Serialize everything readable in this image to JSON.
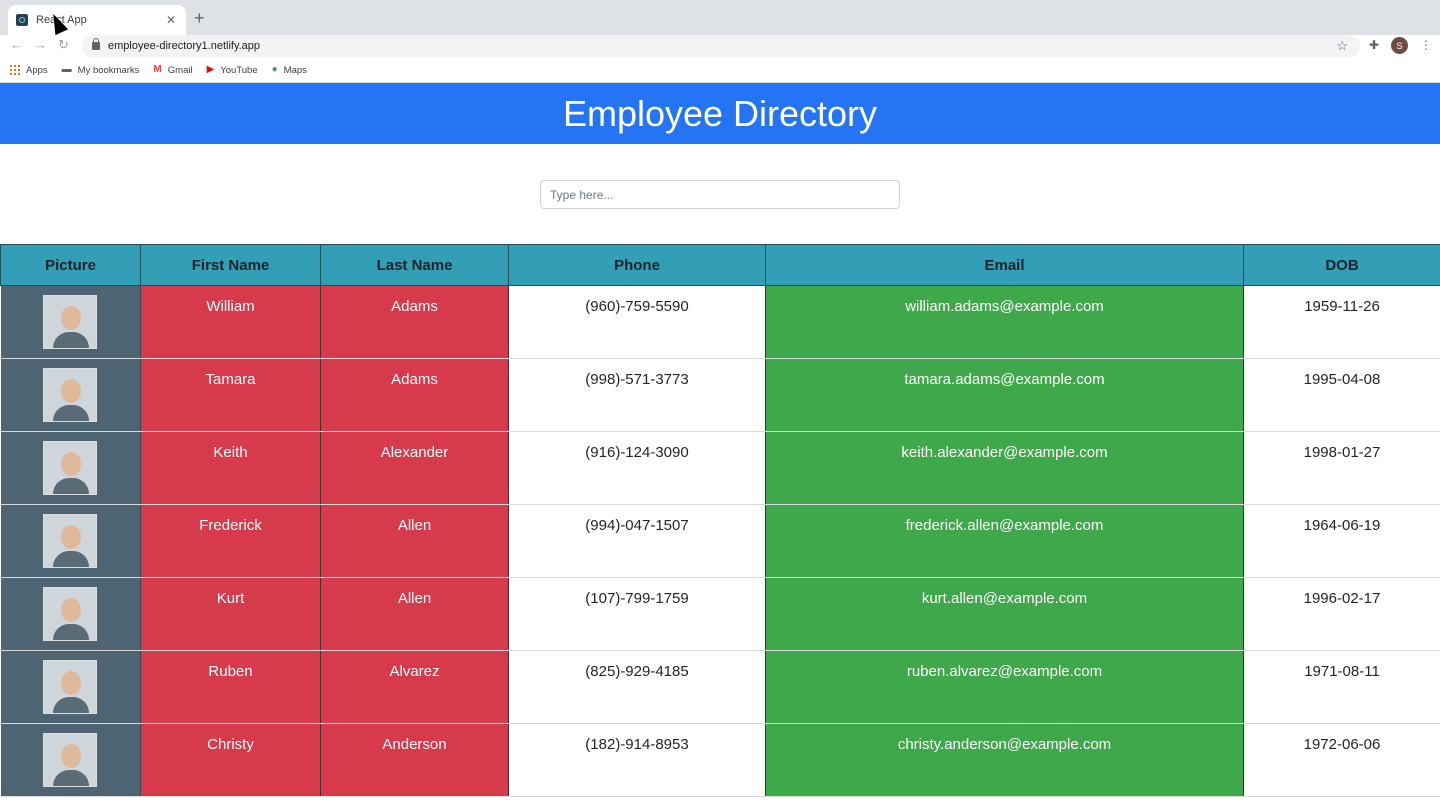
{
  "browser": {
    "tab_title": "React App",
    "url": "employee-directory1.netlify.app",
    "profile_initial": "S",
    "bookmarks": [
      {
        "label": "Apps",
        "icon": "apps-grid-icon"
      },
      {
        "label": "My bookmarks",
        "icon": "folder-icon"
      },
      {
        "label": "Gmail",
        "icon": "gmail-icon"
      },
      {
        "label": "YouTube",
        "icon": "youtube-icon"
      },
      {
        "label": "Maps",
        "icon": "maps-icon"
      }
    ]
  },
  "page": {
    "title": "Employee Directory",
    "search_placeholder": "Type here..."
  },
  "table": {
    "headers": [
      "Picture",
      "First Name",
      "Last Name",
      "Phone",
      "Email",
      "DOB"
    ],
    "rows": [
      {
        "first": "William",
        "last": "Adams",
        "phone": "(960)-759-5590",
        "email": "william.adams@example.com",
        "dob": "1959-11-26"
      },
      {
        "first": "Tamara",
        "last": "Adams",
        "phone": "(998)-571-3773",
        "email": "tamara.adams@example.com",
        "dob": "1995-04-08"
      },
      {
        "first": "Keith",
        "last": "Alexander",
        "phone": "(916)-124-3090",
        "email": "keith.alexander@example.com",
        "dob": "1998-01-27"
      },
      {
        "first": "Frederick",
        "last": "Allen",
        "phone": "(994)-047-1507",
        "email": "frederick.allen@example.com",
        "dob": "1964-06-19"
      },
      {
        "first": "Kurt",
        "last": "Allen",
        "phone": "(107)-799-1759",
        "email": "kurt.allen@example.com",
        "dob": "1996-02-17"
      },
      {
        "first": "Ruben",
        "last": "Alvarez",
        "phone": "(825)-929-4185",
        "email": "ruben.alvarez@example.com",
        "dob": "1971-08-11"
      },
      {
        "first": "Christy",
        "last": "Anderson",
        "phone": "(182)-914-8953",
        "email": "christy.anderson@example.com",
        "dob": "1972-06-06"
      }
    ]
  },
  "colors": {
    "header_bg": "#2574f3",
    "table_header_bg": "#329fb6",
    "picture_col_bg": "#4f6472",
    "name_col_bg": "#d73a4a",
    "email_col_bg": "#3fa84b"
  }
}
